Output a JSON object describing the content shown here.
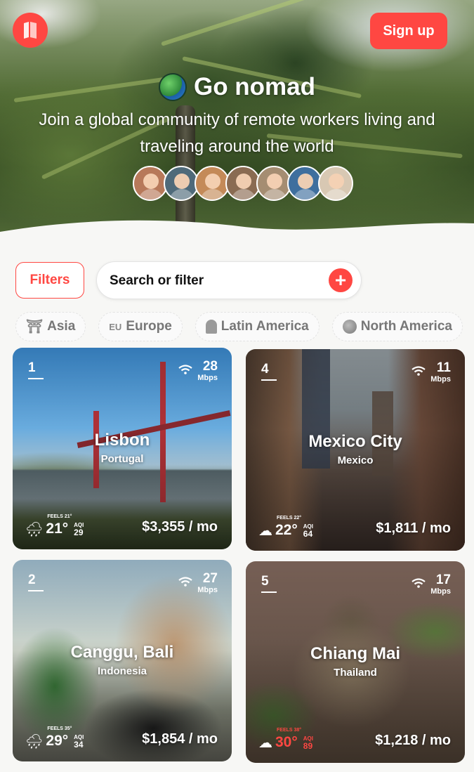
{
  "header": {
    "signup_label": "Sign up",
    "title": "Go nomad",
    "subtitle": "Join a global community of remote workers living and traveling around the world",
    "avatar_count": 7
  },
  "filter_bar": {
    "filters_label": "Filters",
    "search_placeholder": "Search or filter",
    "add_label": "+"
  },
  "regions": [
    {
      "label": "Asia",
      "icon": "torii-icon",
      "icon_glyph": "⛩"
    },
    {
      "label": "Europe",
      "icon": "eu-icon",
      "icon_glyph": "EU"
    },
    {
      "label": "Latin America",
      "icon": "statue-icon",
      "icon_glyph": ""
    },
    {
      "label": "North America",
      "icon": "ball-icon",
      "icon_glyph": ""
    }
  ],
  "cities": [
    {
      "rank": "1",
      "city": "Lisbon",
      "country": "Portugal",
      "wifi": "28",
      "wifi_unit": "Mbps",
      "weather_icon": "rain-cloud-icon",
      "weather_glyph": "🌧",
      "feels": "FEELS 21°",
      "temp": "21°",
      "aqi_label": "AQI",
      "aqi": "29",
      "price": "$3,355 / mo",
      "hot": false
    },
    {
      "rank": "4",
      "city": "Mexico City",
      "country": "Mexico",
      "wifi": "11",
      "wifi_unit": "Mbps",
      "weather_icon": "cloud-icon",
      "weather_glyph": "☁",
      "feels": "FEELS 22°",
      "temp": "22°",
      "aqi_label": "AQI",
      "aqi": "64",
      "price": "$1,811 / mo",
      "hot": false
    },
    {
      "rank": "2",
      "city": "Canggu, Bali",
      "country": "Indonesia",
      "wifi": "27",
      "wifi_unit": "Mbps",
      "weather_icon": "rain-cloud-icon",
      "weather_glyph": "🌧",
      "feels": "FEELS 35°",
      "temp": "29°",
      "aqi_label": "AQI",
      "aqi": "34",
      "price": "$1,854 / mo",
      "hot": false
    },
    {
      "rank": "5",
      "city": "Chiang Mai",
      "country": "Thailand",
      "wifi": "17",
      "wifi_unit": "Mbps",
      "weather_icon": "cloud-icon",
      "weather_glyph": "☁",
      "feels": "FEELS 38°",
      "temp": "30°",
      "aqi_label": "AQI",
      "aqi": "89",
      "price": "$1,218 / mo",
      "hot": true
    }
  ],
  "colors": {
    "brand": "#ff4742"
  }
}
